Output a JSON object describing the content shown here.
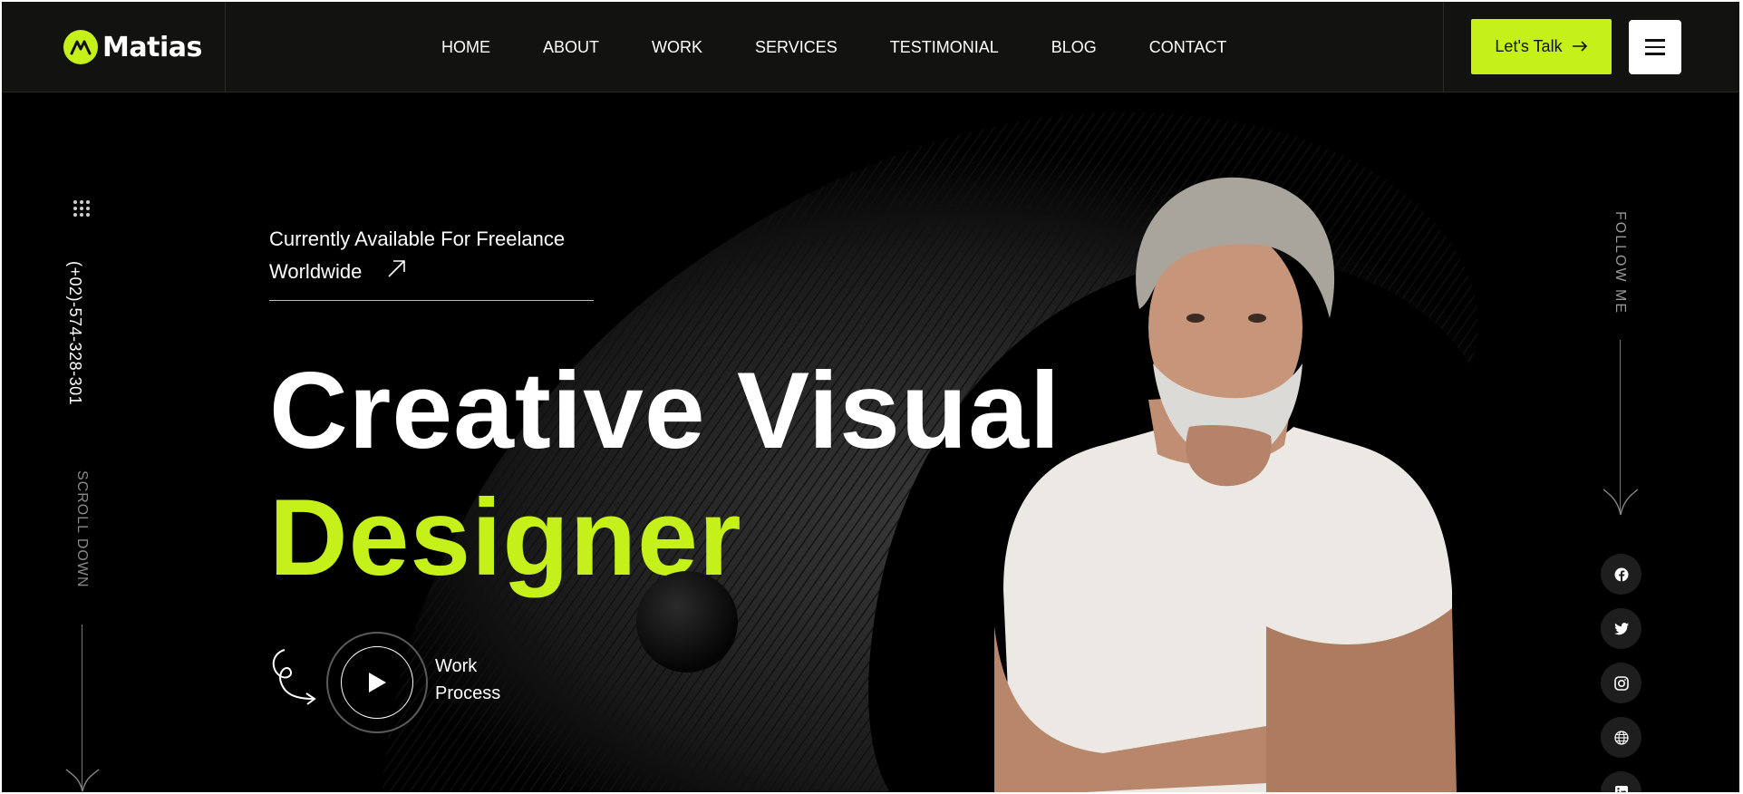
{
  "brand": {
    "name": "Matias",
    "accent_color": "#c6f01a"
  },
  "nav": {
    "items": [
      {
        "label": "HOME"
      },
      {
        "label": "ABOUT"
      },
      {
        "label": "WORK"
      },
      {
        "label": "SERVICES"
      },
      {
        "label": "TESTIMONIAL"
      },
      {
        "label": "BLOG"
      },
      {
        "label": "CONTACT"
      }
    ]
  },
  "header": {
    "cta_label": "Let's Talk",
    "cta_icon": "arrow-right-icon",
    "menu_icon": "hamburger-icon"
  },
  "hero": {
    "phone": "(+02)-574-328-301",
    "scroll_label": "SCROLL DOWN",
    "availability_line1": "Currently Available For Freelance",
    "availability_line2": "Worldwide",
    "headline_white": "Creative Visual",
    "headline_accent": "Designer",
    "video_line1": "Work",
    "video_line2": "Process",
    "follow_label": "FOLLOW ME"
  },
  "social": [
    {
      "icon": "facebook-icon"
    },
    {
      "icon": "twitter-icon"
    },
    {
      "icon": "instagram-icon"
    },
    {
      "icon": "globe-icon"
    },
    {
      "icon": "linkedin-icon"
    }
  ]
}
